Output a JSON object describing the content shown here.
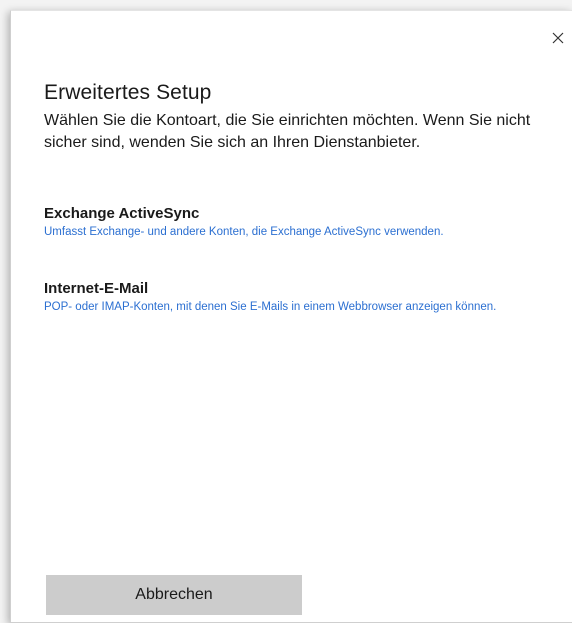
{
  "dialog": {
    "title": "Erweitertes Setup",
    "subtitle": "Wählen Sie die Kontoart, die Sie einrichten möchten. Wenn Sie nicht sicher sind, wenden Sie sich an Ihren Dienstanbieter.",
    "close_icon": "close-icon",
    "options": [
      {
        "name": "Exchange ActiveSync",
        "description": "Umfasst Exchange- und andere Konten, die Exchange ActiveSync verwenden."
      },
      {
        "name": "Internet-E-Mail",
        "description": "POP- oder IMAP-Konten, mit denen Sie E-Mails in einem Webbrowser anzeigen können."
      }
    ],
    "cancel_label": "Abbrechen"
  },
  "colors": {
    "link_blue": "#2b6fd1",
    "button_gray": "#cccccc",
    "text": "#1a1a1a"
  }
}
